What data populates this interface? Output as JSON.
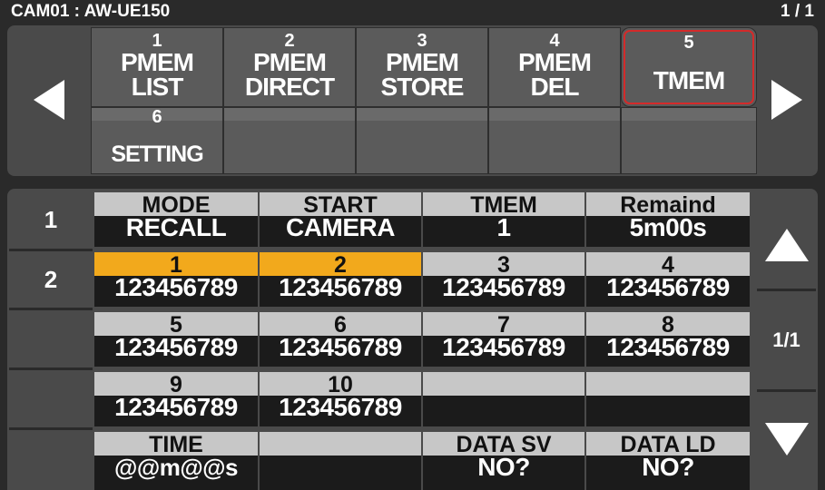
{
  "header": {
    "title": "CAM01 : AW-UE150",
    "page": "1 / 1"
  },
  "menu": {
    "row1": [
      {
        "num": "1",
        "line1": "PMEM",
        "line2": "LIST"
      },
      {
        "num": "2",
        "line1": "PMEM",
        "line2": "DIRECT"
      },
      {
        "num": "3",
        "line1": "PMEM",
        "line2": "STORE"
      },
      {
        "num": "4",
        "line1": "PMEM",
        "line2": "DEL"
      },
      {
        "num": "5",
        "line1": "TMEM",
        "line2": ""
      }
    ],
    "row2": [
      {
        "num": "6",
        "line1": "SETTING"
      }
    ],
    "prev_icon": "left-arrow-icon",
    "next_icon": "right-arrow-icon"
  },
  "table": {
    "row_labels": [
      "1",
      "2"
    ],
    "row1": [
      {
        "top": "MODE",
        "bottom": "RECALL"
      },
      {
        "top": "START",
        "bottom": "CAMERA"
      },
      {
        "top": "TMEM",
        "bottom": "1"
      },
      {
        "top": "Remaind",
        "bottom": "5m00s"
      }
    ],
    "row2": [
      {
        "top": "1",
        "bottom": "123456789"
      },
      {
        "top": "2",
        "bottom": "123456789"
      },
      {
        "top": "3",
        "bottom": "123456789"
      },
      {
        "top": "4",
        "bottom": "123456789"
      }
    ],
    "row3": [
      {
        "top": "5",
        "bottom": "123456789"
      },
      {
        "top": "6",
        "bottom": "123456789"
      },
      {
        "top": "7",
        "bottom": "123456789"
      },
      {
        "top": "8",
        "bottom": "123456789"
      }
    ],
    "row4": [
      {
        "top": "9",
        "bottom": "123456789"
      },
      {
        "top": "10",
        "bottom": "123456789"
      }
    ],
    "row5": [
      {
        "top": "TIME",
        "bottom": "@@m@@s"
      },
      {
        "top": "",
        "bottom": ""
      },
      {
        "top": "DATA SV",
        "bottom": "NO?"
      },
      {
        "top": "DATA LD",
        "bottom": "NO?"
      }
    ]
  },
  "side": {
    "page": "1/1",
    "up_icon": "up-arrow-icon",
    "down_icon": "down-arrow-icon"
  },
  "colors": {
    "selected_cell": "#f2a91c",
    "selected_menu_outline": "#d42a2a",
    "panel": "#4a4a4a",
    "cell_header": "#c7c7c7"
  }
}
